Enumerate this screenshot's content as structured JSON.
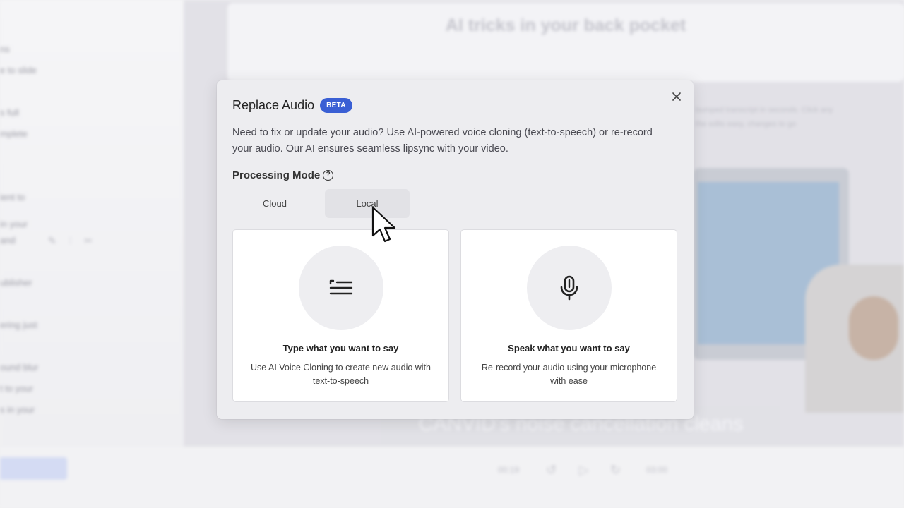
{
  "background": {
    "slide_title": "AI tricks in your back pocket",
    "sidebar_lines": [
      "ns",
      "e to slide",
      "s full",
      "mplete",
      "ient to",
      "in your",
      "and",
      "ublisher",
      "ering just",
      "ound blur",
      "t to your",
      "s in your"
    ],
    "side_text": [
      "bumped transcript in seconds. Click any",
      "the edits easy, changes to go"
    ],
    "caption": "CANVID's noise cancellation cleans",
    "time_current": "00:19",
    "time_total": "03:00"
  },
  "modal": {
    "title": "Replace Audio",
    "badge": "BETA",
    "close_icon": "close-icon",
    "description": "Need to fix or update your audio? Use AI-powered voice cloning (text-to-speech) or re-record your audio. Our AI ensures seamless lipsync with your video.",
    "processing_mode_label": "Processing Mode",
    "help_icon": "?",
    "tabs": [
      {
        "label": "Cloud"
      },
      {
        "label": "Local"
      }
    ],
    "cards": [
      {
        "icon": "text-lines-icon",
        "title": "Type what you want to say",
        "description": "Use AI Voice Cloning to create new audio with text-to-speech"
      },
      {
        "icon": "microphone-icon",
        "title": "Speak what you want to say",
        "description": "Re-record your audio using your microphone with ease"
      }
    ]
  }
}
